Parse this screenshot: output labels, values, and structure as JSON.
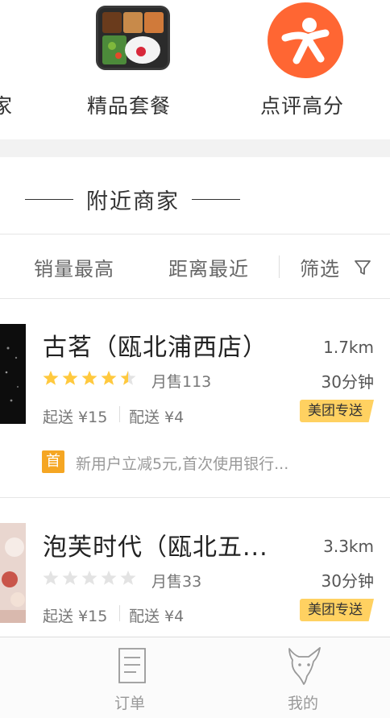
{
  "categories": [
    {
      "label": "家",
      "icon": "shop-icon"
    },
    {
      "label": "精品套餐",
      "icon": "bento-meal-icon"
    },
    {
      "label": "点评高分",
      "icon": "dianping-logo-icon"
    }
  ],
  "section": {
    "title": "附近商家"
  },
  "sort_bar": {
    "by_sales": "销量最高",
    "by_distance": "距离最近",
    "filter": "筛选",
    "filter_icon": "funnel-icon"
  },
  "shops": [
    {
      "name": "古茗（瓯北浦西店）",
      "distance": "1.7km",
      "rating": 4.5,
      "monthly_sales": "月售113",
      "delivery_time": "30分钟",
      "min_order": "起送 ¥15",
      "delivery_fee": "配送 ¥4",
      "badge": "美团专送",
      "promo_tag": "首",
      "promo_text": "新用户立减5元,首次使用银行..."
    },
    {
      "name": "泡芙时代（瓯北五...",
      "distance": "3.3km",
      "rating": 0,
      "monthly_sales": "月售33",
      "delivery_time": "30分钟",
      "min_order": "起送 ¥15",
      "delivery_fee": "配送 ¥4",
      "badge": "美团专送"
    }
  ],
  "tabbar": {
    "orders": "订单",
    "orders_icon": "order-list-icon",
    "mine": "我的",
    "mine_icon": "kangaroo-profile-icon"
  },
  "colors": {
    "accent_orange": "#ff6633",
    "star_yellow": "#ffc93e",
    "badge_yellow": "#ffd161",
    "promo_orange": "#f5a623"
  }
}
